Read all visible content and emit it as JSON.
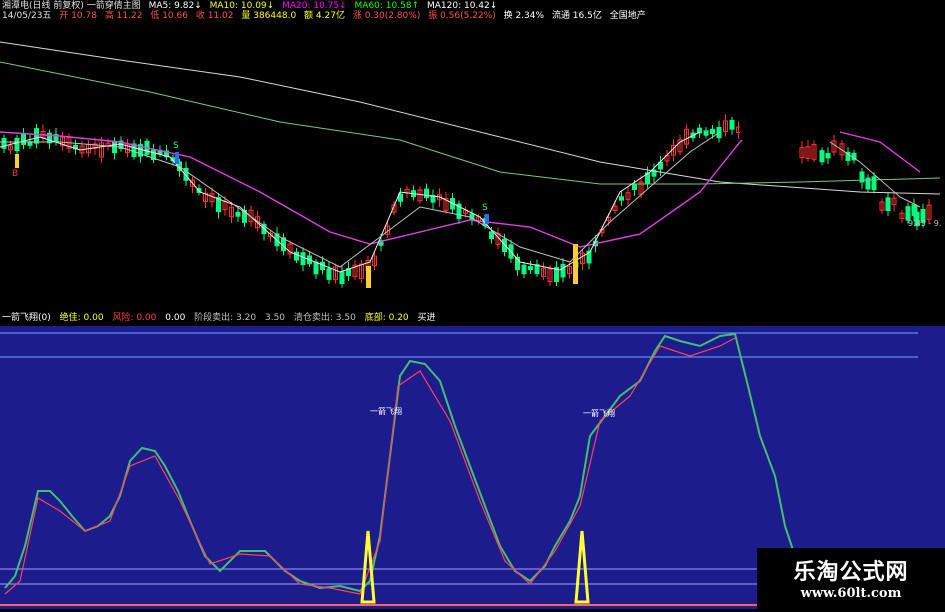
{
  "colors": {
    "ma5": "#ffffff",
    "ma10": "#ffff00",
    "ma20": "#ff00ff",
    "ma60": "#00ff00",
    "ma120": "#ffffff",
    "up_candle": "#ff3030",
    "down_candle": "#00ff80",
    "indicator_bg": "#1c1c8c",
    "signal": "#ffff33"
  },
  "header": {
    "title": "湘潭电(日线 前复权) 一箭穿倩主图",
    "ma5": "MA5: 9.82↓",
    "ma10": "MA10: 10.09↓",
    "ma20": "MA20: 10.75↓",
    "ma60": "MA60: 10.58↑",
    "ma120": "MA120: 10.42↓",
    "date": "14/05/23五",
    "open": "开 10.78",
    "high": "高 11.22",
    "low": "低 10.66",
    "close": "收 11.02",
    "volume": "量 386448.0",
    "amount": "额 4.27亿",
    "change": "涨 0.30(2.80%)",
    "amplitude": "振 0.56(5.22%)",
    "turnover": "换 2.34%",
    "float_cap": "流通 16.5亿",
    "sector": "全国地产"
  },
  "chart_price_label": "9.83 - 9.",
  "signal_s_1": "S",
  "signal_s_2": "S",
  "signal_b": "B",
  "indicator": {
    "title": "一箭飞翔(0)",
    "items": [
      "绝佳: 0.00",
      "风险: 0.00",
      "0.00",
      "阶段卖出: 3.20",
      "3.50",
      "清仓卖出: 3.50",
      "底部: 0.20",
      "买进"
    ],
    "annotation_1": "一箭飞翔",
    "annotation_2": "一箭飞翔"
  },
  "watermark": {
    "title": "乐淘公式网",
    "url": "www.60lt.com"
  }
}
